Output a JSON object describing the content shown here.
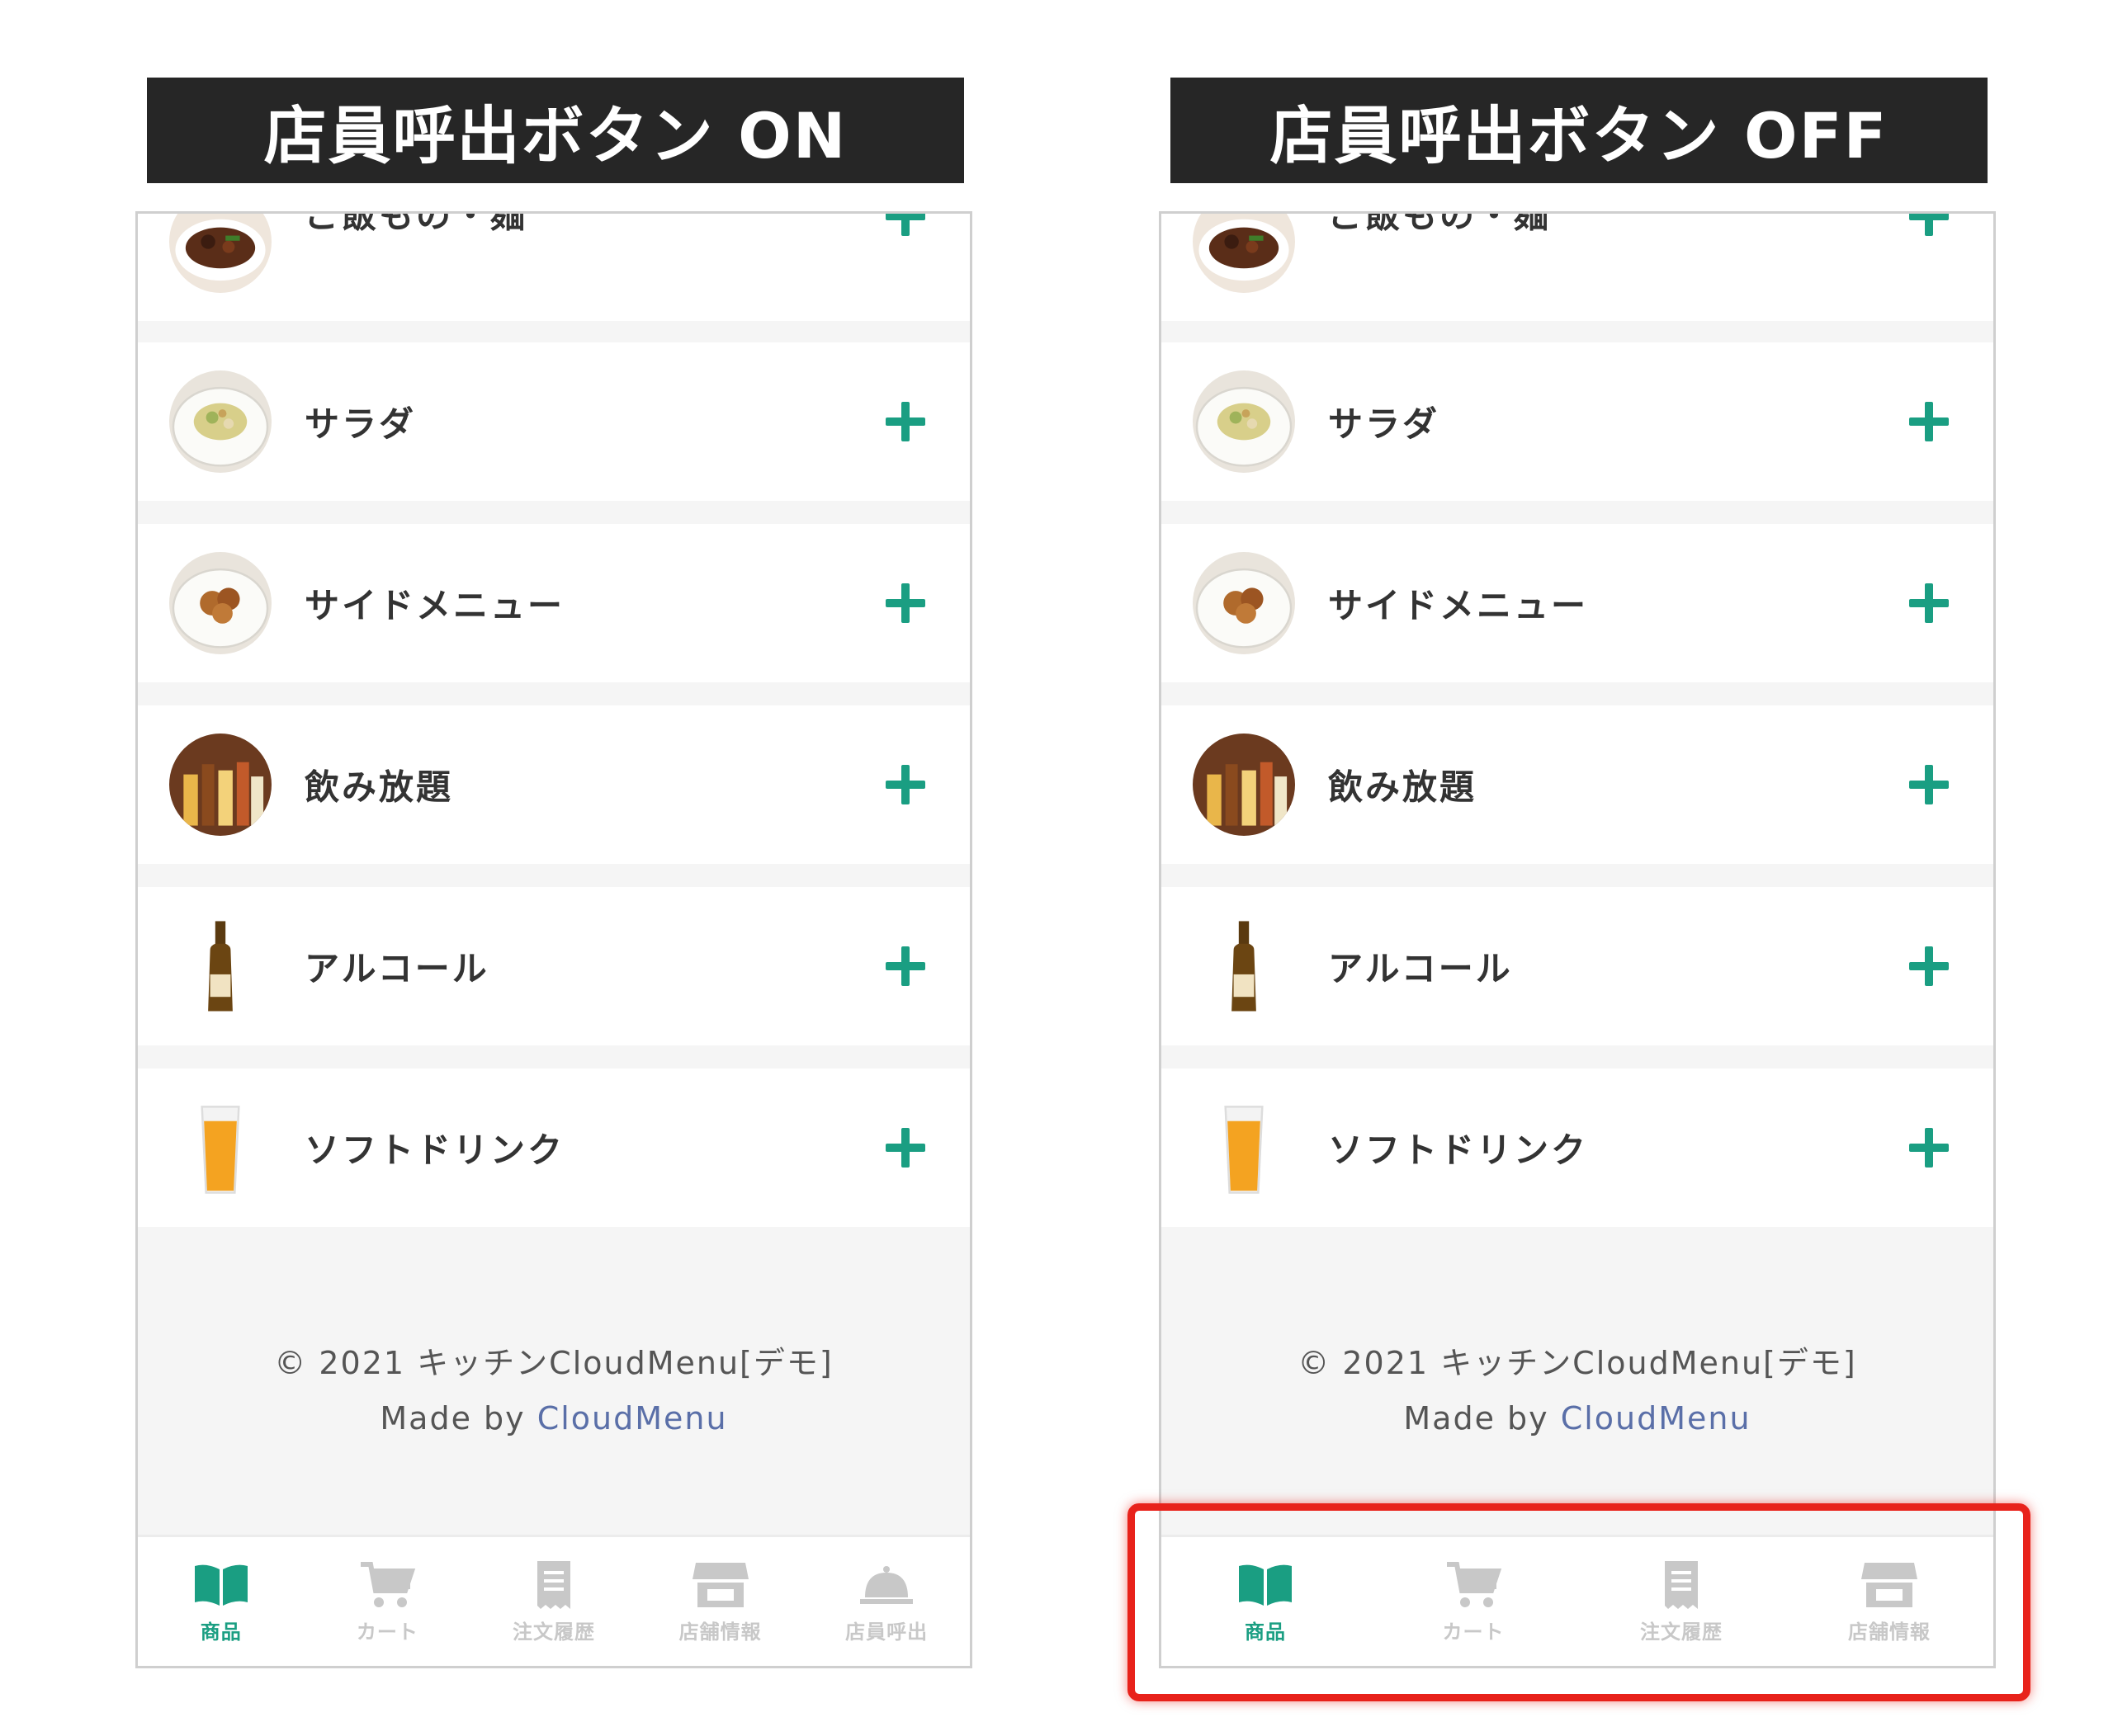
{
  "panels": [
    {
      "title": "店員呼出ボタン ON",
      "categories": [
        {
          "label": "ご飯もの・麺",
          "thumb": "rice-noodle-dish-photo"
        },
        {
          "label": "サラダ",
          "thumb": "salad-photo"
        },
        {
          "label": "サイドメニュー",
          "thumb": "fried-chicken-photo"
        },
        {
          "label": "飲み放題",
          "thumb": "all-you-can-drink-photo"
        },
        {
          "label": "アルコール",
          "thumb": "beer-bottle-photo"
        },
        {
          "label": "ソフトドリンク",
          "thumb": "orange-juice-photo"
        }
      ],
      "footer": {
        "copyright": "© 2021 キッチンCloudMenu[デモ]",
        "made_by": "Made by ",
        "link": "CloudMenu"
      },
      "tabs": [
        {
          "label": "商品",
          "icon": "open-book-icon",
          "active": true
        },
        {
          "label": "カート",
          "icon": "cart-icon",
          "active": false
        },
        {
          "label": "注文履歴",
          "icon": "receipt-icon",
          "active": false
        },
        {
          "label": "店舗情報",
          "icon": "store-icon",
          "active": false
        },
        {
          "label": "店員呼出",
          "icon": "service-bell-icon",
          "active": false
        }
      ]
    },
    {
      "title": "店員呼出ボタン OFF",
      "categories": [
        {
          "label": "ご飯もの・麺",
          "thumb": "rice-noodle-dish-photo"
        },
        {
          "label": "サラダ",
          "thumb": "salad-photo"
        },
        {
          "label": "サイドメニュー",
          "thumb": "fried-chicken-photo"
        },
        {
          "label": "飲み放題",
          "thumb": "all-you-can-drink-photo"
        },
        {
          "label": "アルコール",
          "thumb": "beer-bottle-photo"
        },
        {
          "label": "ソフトドリンク",
          "thumb": "orange-juice-photo"
        }
      ],
      "footer": {
        "copyright": "© 2021 キッチンCloudMenu[デモ]",
        "made_by": "Made by ",
        "link": "CloudMenu"
      },
      "tabs": [
        {
          "label": "商品",
          "icon": "open-book-icon",
          "active": true
        },
        {
          "label": "カート",
          "icon": "cart-icon",
          "active": false
        },
        {
          "label": "注文履歴",
          "icon": "receipt-icon",
          "active": false
        },
        {
          "label": "店舗情報",
          "icon": "store-icon",
          "active": false
        }
      ]
    }
  ],
  "colors": {
    "accent": "#1a9e82",
    "inactive": "#c8c8c8",
    "highlight": "#e8221b",
    "title_bar": "#262626",
    "link": "#5a6fa8"
  }
}
